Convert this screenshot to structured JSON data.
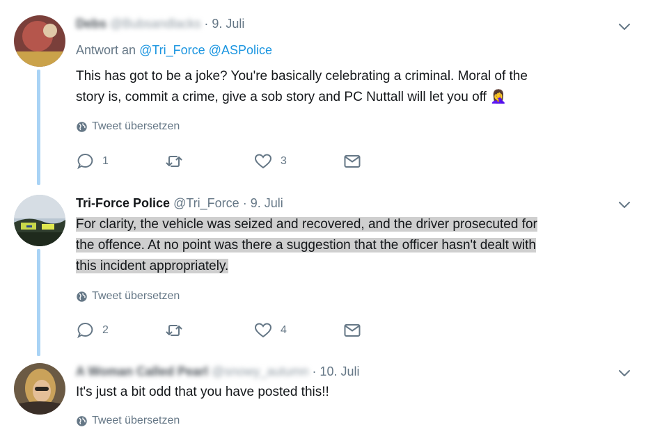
{
  "tweets": [
    {
      "name": "Debs",
      "handle": "@Bubsandlacks",
      "date": "· 9. Juli",
      "reply_label": "Antwort an",
      "reply_handles": "@Tri_Force @ASPolice",
      "text_lines": [
        "This has got to be a joke? You're basically celebrating a criminal. Moral of the",
        "story is, commit a crime, give a sob story and PC Nuttall will let you off"
      ],
      "emoji": "🤦‍♀️",
      "translate": "Tweet übersetzen",
      "replies": "1",
      "retweets": "",
      "likes": "3"
    },
    {
      "name": "Tri-Force Police",
      "handle": "@Tri_Force",
      "date": "· 9. Juli",
      "text_lines": [
        "For clarity, the vehicle was seized and recovered, and the driver prosecuted for",
        "the offence. At no point was there a suggestion that the officer hasn't dealt with",
        "this incident appropriately."
      ],
      "translate": "Tweet übersetzen",
      "replies": "2",
      "retweets": "",
      "likes": "4"
    },
    {
      "name": "A Woman Called Pearl",
      "handle": "@snowy_autumn",
      "date": "· 10. Juli",
      "text_lines": [
        "It's just a bit odd that you have posted this!!"
      ],
      "translate": "Tweet übersetzen"
    }
  ],
  "icons": {
    "reply": "reply-icon",
    "retweet": "retweet-icon",
    "like": "heart-icon",
    "dm": "envelope-icon",
    "translate": "globe-icon",
    "menu": "chevron-down-icon"
  },
  "colors": {
    "link": "#1b95e0",
    "thread_line": "#a9d3f5",
    "secondary_text": "#657786",
    "highlight": "#cfcfcf"
  }
}
